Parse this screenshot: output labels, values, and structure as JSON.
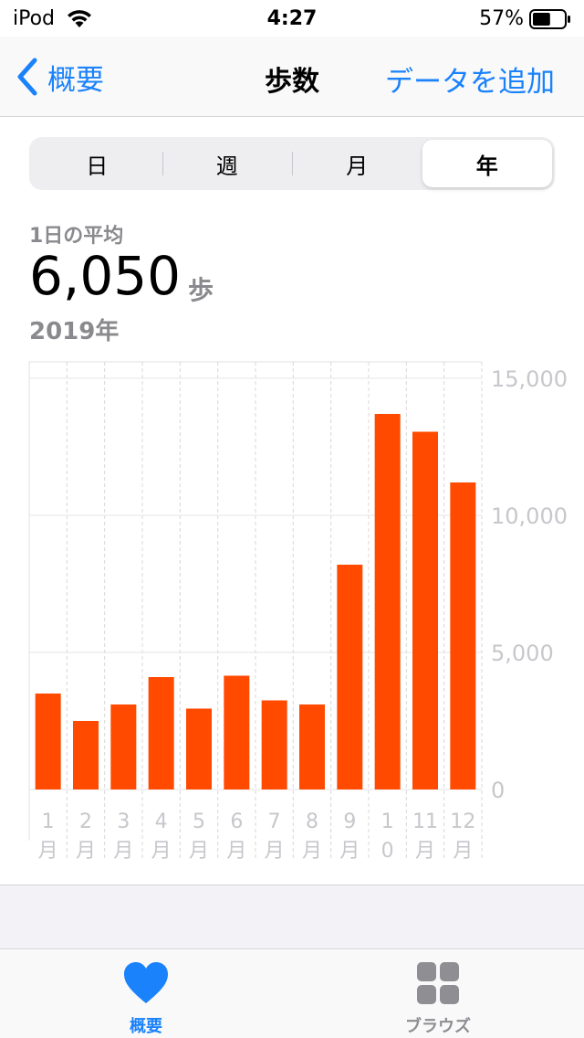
{
  "status_bar": {
    "carrier": "iPod",
    "time": "4:27",
    "battery": "57%",
    "battery_level": 0.57
  },
  "nav": {
    "back_label": "概要",
    "title": "歩数",
    "add_label": "データを追加"
  },
  "segments": [
    {
      "label": "日",
      "active": false
    },
    {
      "label": "週",
      "active": false
    },
    {
      "label": "月",
      "active": false
    },
    {
      "label": "年",
      "active": true
    }
  ],
  "summary": {
    "label": "1日の平均",
    "value": "6,050",
    "unit": "歩",
    "period": "2019年"
  },
  "colors": {
    "accent": "#1a82fb",
    "bar": "#ff4a00",
    "secondary_text": "#8a8a8e"
  },
  "chart_data": {
    "type": "bar",
    "categories": [
      "1月",
      "2月",
      "3月",
      "4月",
      "5月",
      "6月",
      "7月",
      "8月",
      "9月",
      "10月",
      "11月",
      "12月"
    ],
    "category_labels": [
      [
        "1",
        "月"
      ],
      [
        "2",
        "月"
      ],
      [
        "3",
        "月"
      ],
      [
        "4",
        "月"
      ],
      [
        "5",
        "月"
      ],
      [
        "6",
        "月"
      ],
      [
        "7",
        "月"
      ],
      [
        "8",
        "月"
      ],
      [
        "9",
        "月"
      ],
      [
        "1",
        "0"
      ],
      [
        "11",
        "月"
      ],
      [
        "12",
        "月"
      ]
    ],
    "values": [
      3500,
      2500,
      3100,
      4100,
      2950,
      4150,
      3250,
      3100,
      8200,
      13700,
      13050,
      11200
    ],
    "ylim": [
      0,
      15000
    ],
    "yticks": [
      0,
      5000,
      10000,
      15000
    ],
    "ytick_labels": [
      "0",
      "5,000",
      "10,000",
      "15,000"
    ],
    "grid": true,
    "y_axis_position": "right"
  },
  "tabs": [
    {
      "label": "概要",
      "icon": "heart-icon",
      "active": true
    },
    {
      "label": "ブラウズ",
      "icon": "grid-icon",
      "active": false
    }
  ]
}
